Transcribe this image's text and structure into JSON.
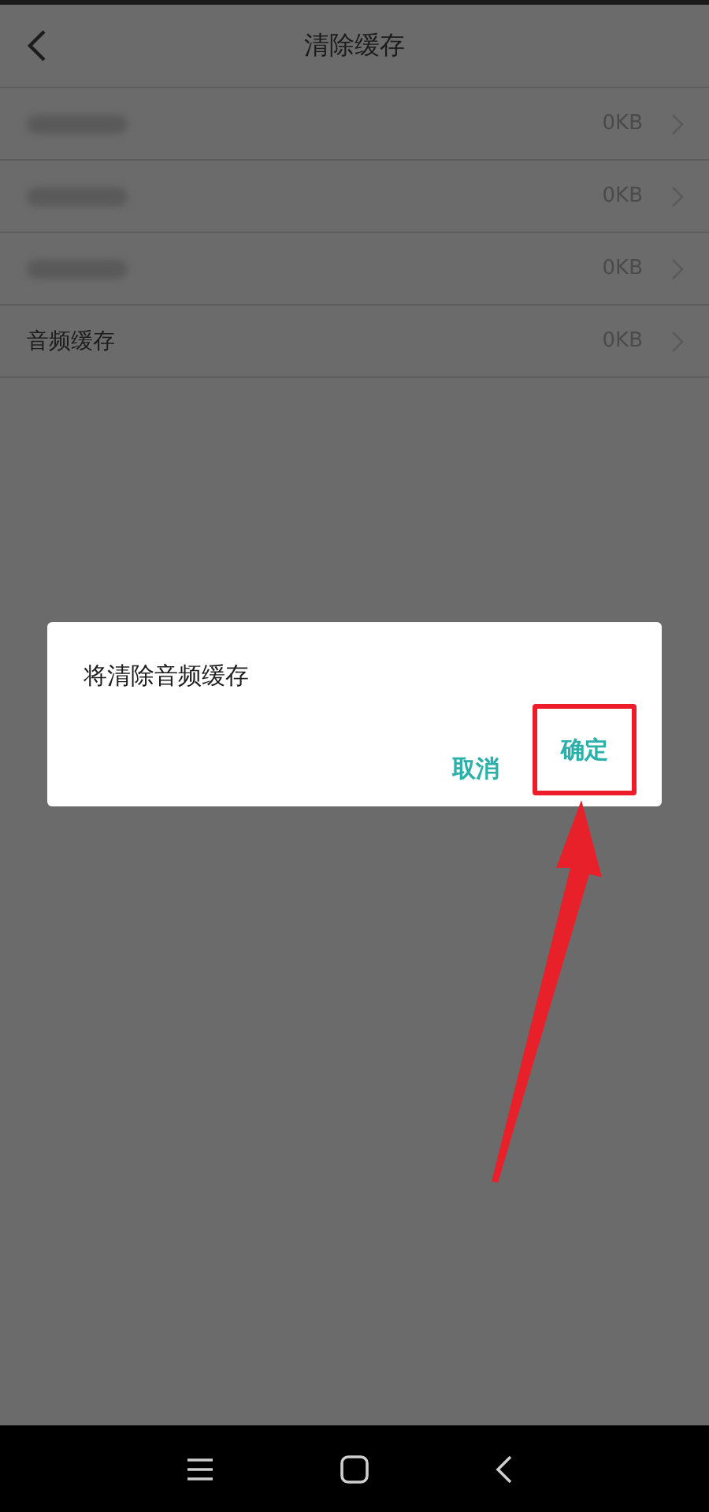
{
  "header": {
    "title": "清除缓存"
  },
  "items": [
    {
      "kind": "blurred",
      "size": "0KB"
    },
    {
      "kind": "blurred",
      "size": "0KB"
    },
    {
      "kind": "blurred",
      "size": "0KB"
    },
    {
      "kind": "text",
      "label": "音频缓存",
      "size": "0KB"
    }
  ],
  "dialog": {
    "message": "将清除音频缓存",
    "buttons": [
      {
        "label": "取消",
        "highlighted": false
      },
      {
        "label": "确定",
        "highlighted": true
      }
    ]
  }
}
